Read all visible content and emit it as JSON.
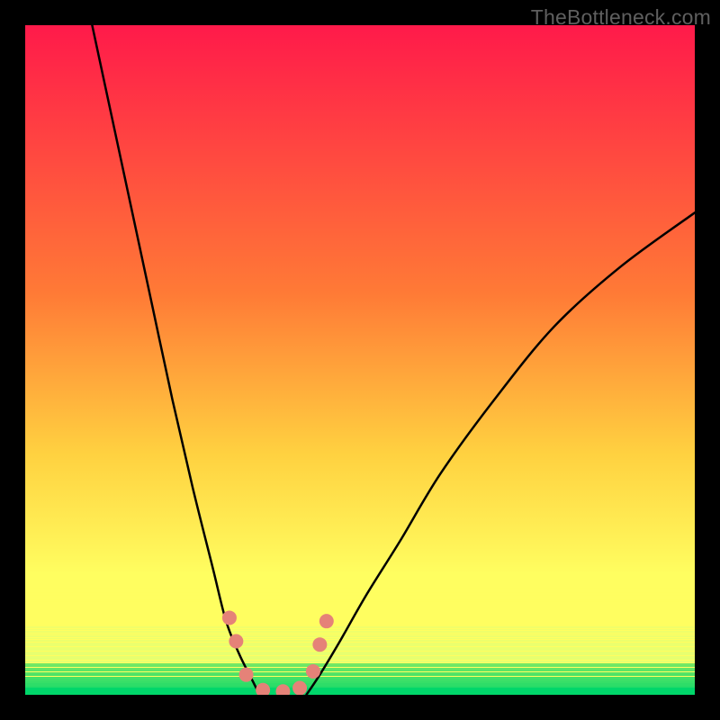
{
  "watermark": {
    "text": "TheBottleneck.com"
  },
  "colors": {
    "frame_bg": "#000000",
    "gradient_top": "#ff1a4a",
    "gradient_mid1": "#ff7a36",
    "gradient_mid2": "#ffd140",
    "gradient_bottom": "#fffe60",
    "green_light": "#d8ff7a",
    "green_deep": "#00d66a",
    "curve_stroke": "#000000",
    "blob_fill": "#e58278"
  },
  "chart_data": {
    "type": "line",
    "title": "",
    "xlabel": "",
    "ylabel": "",
    "x_range": [
      0,
      100
    ],
    "y_range": [
      0,
      100
    ],
    "note": "V-shaped bottleneck curve; y is low near the valley (good / green) and high at the extremes (bad / red). Rendered over a vertical red→yellow→green heat gradient with no numeric axes.",
    "series": [
      {
        "name": "left-curve",
        "x": [
          10,
          13,
          16,
          19,
          22,
          25,
          28,
          30,
          32,
          34,
          35
        ],
        "y": [
          100,
          86,
          72,
          58,
          44,
          31,
          19,
          11,
          6,
          2,
          0
        ]
      },
      {
        "name": "right-curve",
        "x": [
          42,
          44,
          47,
          51,
          56,
          62,
          70,
          79,
          89,
          100
        ],
        "y": [
          0,
          3,
          8,
          15,
          23,
          33,
          44,
          55,
          64,
          72
        ]
      }
    ],
    "valley_blobs": {
      "name": "valley-markers",
      "points": [
        {
          "x": 30.5,
          "y": 11.5
        },
        {
          "x": 31.5,
          "y": 8.0
        },
        {
          "x": 33.0,
          "y": 3.0
        },
        {
          "x": 35.5,
          "y": 0.7
        },
        {
          "x": 38.5,
          "y": 0.5
        },
        {
          "x": 41.0,
          "y": 1.0
        },
        {
          "x": 43.0,
          "y": 3.5
        },
        {
          "x": 44.0,
          "y": 7.5
        },
        {
          "x": 45.0,
          "y": 11.0
        }
      ],
      "radius": 8
    },
    "green_band_region": {
      "y_from": 0,
      "y_to": 16
    }
  }
}
